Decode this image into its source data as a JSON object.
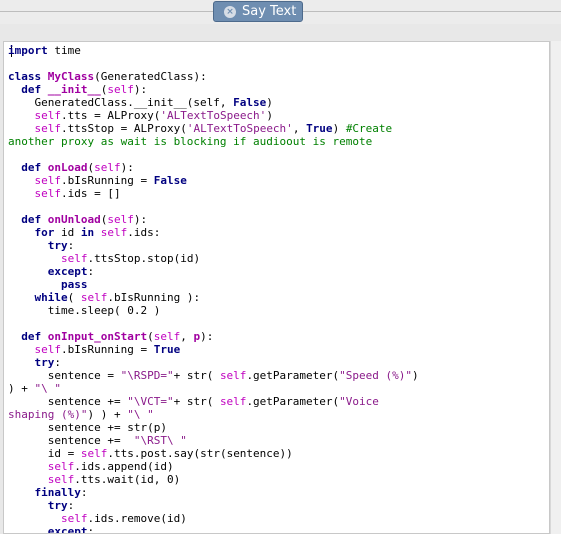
{
  "window": {
    "tab_label": "Say Text",
    "close_glyph": "×"
  },
  "colors": {
    "keyword": "#000080",
    "self": "#c000c0",
    "string": "#8a1a8a",
    "comment": "#008000",
    "tab": "#6f8eb1"
  },
  "code": {
    "lines": [
      [
        [
          "kw",
          "import"
        ],
        [
          "",
          "  time"
        ]
      ],
      [],
      [
        [
          "kw",
          "class"
        ],
        [
          "",
          "  "
        ],
        [
          "fn",
          "MyClass"
        ],
        [
          "",
          "(GeneratedClass):"
        ]
      ],
      [
        [
          "",
          "    "
        ],
        [
          "kw",
          "def"
        ],
        [
          "",
          "  "
        ],
        [
          "fn",
          "__init__"
        ],
        [
          "",
          "("
        ],
        [
          "self",
          "self"
        ],
        [
          "",
          "):"
        ]
      ],
      [
        [
          "",
          "        GeneratedClass.__init__(self,  "
        ],
        [
          "kw",
          "False"
        ],
        [
          "",
          ")"
        ]
      ],
      [
        [
          "",
          "        "
        ],
        [
          "self",
          "self"
        ],
        [
          "",
          ".tts  =  ALProxy("
        ],
        [
          "str",
          "'ALTextToSpeech'"
        ],
        [
          "",
          ")"
        ]
      ],
      [
        [
          "",
          "        "
        ],
        [
          "self",
          "self"
        ],
        [
          "",
          ".ttsStop  =  ALProxy("
        ],
        [
          "str",
          "'ALTextToSpeech'"
        ],
        [
          "",
          ",  "
        ],
        [
          "kw",
          "True"
        ],
        [
          "",
          ")  "
        ],
        [
          "cm",
          "#Create"
        ]
      ],
      [
        [
          "cm",
          "another  proxy  as  wait  is  blocking  if  audioout  is  remote"
        ]
      ],
      [],
      [
        [
          "",
          "    "
        ],
        [
          "kw",
          "def"
        ],
        [
          "",
          "  "
        ],
        [
          "fn",
          "onLoad"
        ],
        [
          "",
          "("
        ],
        [
          "self",
          "self"
        ],
        [
          "",
          "):"
        ]
      ],
      [
        [
          "",
          "        "
        ],
        [
          "self",
          "self"
        ],
        [
          "",
          ".bIsRunning  =  "
        ],
        [
          "kw",
          "False"
        ]
      ],
      [
        [
          "",
          "        "
        ],
        [
          "self",
          "self"
        ],
        [
          "",
          ".ids  =  []"
        ]
      ],
      [],
      [
        [
          "",
          "    "
        ],
        [
          "kw",
          "def"
        ],
        [
          "",
          "  "
        ],
        [
          "fn",
          "onUnload"
        ],
        [
          "",
          "("
        ],
        [
          "self",
          "self"
        ],
        [
          "",
          "):"
        ]
      ],
      [
        [
          "",
          "        "
        ],
        [
          "kw",
          "for"
        ],
        [
          "",
          "  id  "
        ],
        [
          "kw",
          "in"
        ],
        [
          "",
          "  "
        ],
        [
          "self",
          "self"
        ],
        [
          "",
          ".ids:"
        ]
      ],
      [
        [
          "",
          "            "
        ],
        [
          "kw",
          "try"
        ],
        [
          "",
          ":"
        ]
      ],
      [
        [
          "",
          "                "
        ],
        [
          "self",
          "self"
        ],
        [
          "",
          ".ttsStop.stop(id)"
        ]
      ],
      [
        [
          "",
          "            "
        ],
        [
          "kw",
          "except"
        ],
        [
          "",
          ":"
        ]
      ],
      [
        [
          "",
          "                "
        ],
        [
          "kw",
          "pass"
        ]
      ],
      [
        [
          "",
          "        "
        ],
        [
          "kw",
          "while"
        ],
        [
          "",
          "(  "
        ],
        [
          "self",
          "self"
        ],
        [
          "",
          ".bIsRunning  ):"
        ]
      ],
      [
        [
          "",
          "            time.sleep(  0.2  )"
        ]
      ],
      [],
      [
        [
          "",
          "    "
        ],
        [
          "kw",
          "def"
        ],
        [
          "",
          "  "
        ],
        [
          "fn",
          "onInput_onStart"
        ],
        [
          "",
          "("
        ],
        [
          "self",
          "self"
        ],
        [
          "",
          ",  "
        ],
        [
          "fn",
          "p"
        ],
        [
          "",
          "):"
        ]
      ],
      [
        [
          "",
          "        "
        ],
        [
          "self",
          "self"
        ],
        [
          "",
          ".bIsRunning  =  "
        ],
        [
          "kw",
          "True"
        ]
      ],
      [
        [
          "",
          "        "
        ],
        [
          "kw",
          "try"
        ],
        [
          "",
          ":"
        ]
      ],
      [
        [
          "",
          "            sentence  =  "
        ],
        [
          "str",
          "\"\\RSPD=\""
        ],
        [
          "",
          "+  str(  "
        ],
        [
          "self",
          "self"
        ],
        [
          "",
          ".getParameter("
        ],
        [
          "str",
          "\"Speed  (%)\""
        ],
        [
          "",
          ")"
        ]
      ],
      [
        [
          "",
          ")  +  "
        ],
        [
          "str",
          "\"\\  \""
        ]
      ],
      [
        [
          "",
          "            sentence  +=  "
        ],
        [
          "str",
          "\"\\VCT=\""
        ],
        [
          "",
          "+  str(  "
        ],
        [
          "self",
          "self"
        ],
        [
          "",
          ".getParameter("
        ],
        [
          "str",
          "\"Voice"
        ]
      ],
      [
        [
          "str",
          "shaping  (%)\""
        ],
        [
          "",
          ")  )  +  "
        ],
        [
          "str",
          "\"\\  \""
        ]
      ],
      [
        [
          "",
          "            sentence  +=  str(p)"
        ]
      ],
      [
        [
          "",
          "            sentence  +=    "
        ],
        [
          "str",
          "\"\\RST\\  \""
        ]
      ],
      [
        [
          "",
          "            id  =  "
        ],
        [
          "self",
          "self"
        ],
        [
          "",
          ".tts.post.say(str(sentence))"
        ]
      ],
      [
        [
          "",
          "            "
        ],
        [
          "self",
          "self"
        ],
        [
          "",
          ".ids.append(id)"
        ]
      ],
      [
        [
          "",
          "            "
        ],
        [
          "self",
          "self"
        ],
        [
          "",
          ".tts.wait(id,  0)"
        ]
      ],
      [
        [
          "",
          "        "
        ],
        [
          "kw",
          "finally"
        ],
        [
          "",
          ":"
        ]
      ],
      [
        [
          "",
          "            "
        ],
        [
          "kw",
          "try"
        ],
        [
          "",
          ":"
        ]
      ],
      [
        [
          "",
          "                "
        ],
        [
          "self",
          "self"
        ],
        [
          "",
          ".ids.remove(id)"
        ]
      ],
      [
        [
          "",
          "            "
        ],
        [
          "kw",
          "except"
        ],
        [
          "",
          ":"
        ]
      ]
    ]
  }
}
